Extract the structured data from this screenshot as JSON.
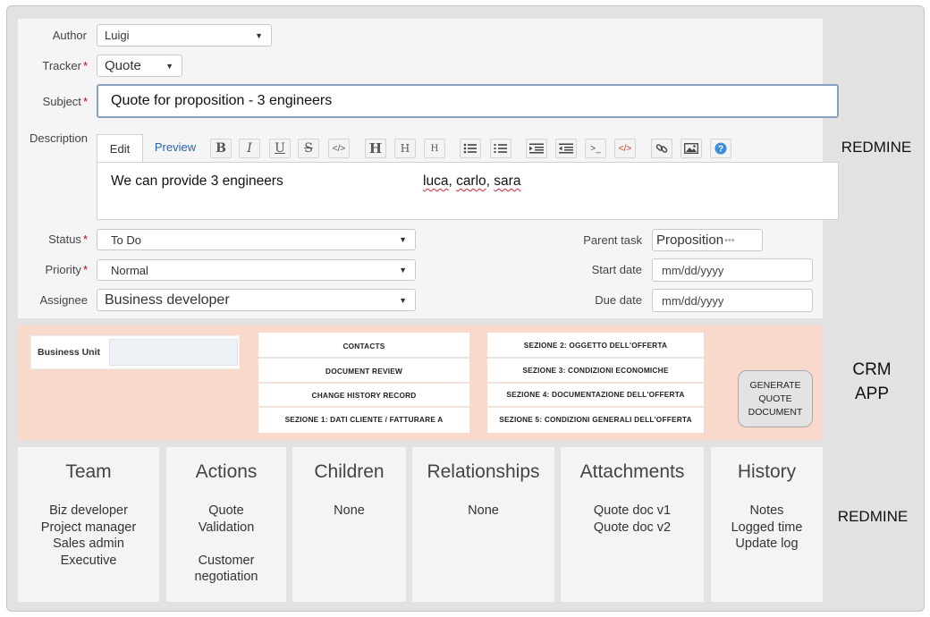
{
  "form": {
    "author": {
      "label": "Author",
      "value": "Luigi"
    },
    "tracker": {
      "label": "Tracker",
      "value": "Quote"
    },
    "subject": {
      "label": "Subject",
      "value": "Quote for proposition - 3 engineers"
    },
    "description": {
      "label": "Description",
      "tab_edit": "Edit",
      "tab_preview": "Preview",
      "text": "We can provide 3 engineers",
      "names": [
        "luca",
        "carlo",
        "sara"
      ]
    },
    "status": {
      "label": "Status",
      "value": "To Do"
    },
    "priority": {
      "label": "Priority",
      "value": "Normal"
    },
    "assignee": {
      "label": "Assignee",
      "value": "Business developer"
    },
    "parent_task": {
      "label": "Parent task",
      "value": "Proposition"
    },
    "start_date": {
      "label": "Start date",
      "placeholder": "mm/dd/yyyy"
    },
    "due_date": {
      "label": "Due date",
      "placeholder": "mm/dd/yyyy"
    }
  },
  "toolbar": {
    "bold": "B",
    "italic": "I",
    "underline": "U",
    "strike": "S",
    "code": "</>",
    "h1": "H",
    "h2": "H",
    "h3": "H"
  },
  "crm": {
    "business_unit_label": "Business Unit",
    "col1": [
      "CONTACTS",
      "DOCUMENT REVIEW",
      "CHANGE HISTORY RECORD",
      "SEZIONE 1: DATI CLIENTE / FATTURARE A"
    ],
    "col2": [
      "SEZIONE 2: OGGETTO DELL'OFFERTA",
      "SEZIONE 3: CONDIZIONI ECONOMICHE",
      "SEZIONE 4: DOCUMENTAZIONE DELL'OFFERTA",
      "SEZIONE 5: CONDIZIONI GENERALI DELL'OFFERTA"
    ],
    "generate_button": [
      "GENERATE",
      "QUOTE",
      "DOCUMENT"
    ]
  },
  "cards": [
    {
      "title": "Team",
      "lines": [
        "Biz developer",
        "Project manager",
        "Sales admin",
        "Executive"
      ]
    },
    {
      "title": "Actions",
      "lines": [
        "Quote",
        "Validation",
        "",
        "Customer",
        "negotiation"
      ]
    },
    {
      "title": "Children",
      "lines": [
        "None"
      ]
    },
    {
      "title": "Relationships",
      "lines": [
        "None"
      ]
    },
    {
      "title": "Attachments",
      "lines": [
        "Quote doc v1",
        "Quote doc v2"
      ]
    },
    {
      "title": "History",
      "lines": [
        "Notes",
        "Logged time",
        "Update log"
      ]
    }
  ],
  "side_labels": {
    "top": "REDMINE",
    "middle": [
      "CRM",
      "APP"
    ],
    "bottom": "REDMINE"
  },
  "colors": {
    "required": "#cc0000",
    "crm_band": "#f9d9cb",
    "link": "#2a64b0"
  }
}
